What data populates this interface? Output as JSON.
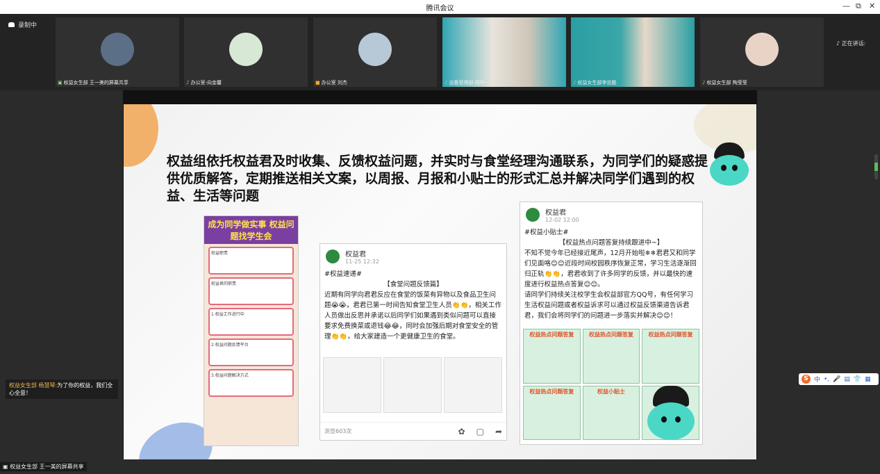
{
  "window": {
    "title": "腾讯会议",
    "controls": [
      "—",
      "⧉",
      "✕"
    ]
  },
  "recording": {
    "label": "录制中"
  },
  "participants": [
    {
      "name": "权益女生部 王一美的屏幕共享",
      "avatar_color": "#5b6f86",
      "type": "avatar"
    },
    {
      "name": "办公室-向金馨",
      "avatar_color": "#d7e9d4",
      "type": "avatar"
    },
    {
      "name": "办公室 刘杰",
      "avatar_color": "#b7c9d6",
      "type": "avatar"
    },
    {
      "name": "设备管理部-顾梓一",
      "avatar_color": "#46b6bf",
      "type": "camera"
    },
    {
      "name": "权益女生部李忠懿",
      "avatar_color": "#3aa6a8",
      "type": "camera"
    },
    {
      "name": "权益女生部 陶莹莹",
      "avatar_color": "#e9d3c7",
      "type": "avatar"
    }
  ],
  "speaking": {
    "label": "正在讲话:"
  },
  "slide": {
    "headline": "权益组依托权益君及时收集、反馈权益问题，并实时与食堂经理沟通联系，为同学们的疑惑提供优质解答，定期推送相关文案，以周报、月报和小贴士的形式汇总并解决同学们遇到的权益、生活等问题",
    "poster": {
      "header": "成为同学做实事 权益问题找学生会",
      "sections": [
        "权益职责",
        "权益君的职责",
        "1.权益工作进行中",
        "2.权益问题反馈平台",
        "3.权益问题解决方式"
      ]
    },
    "post1": {
      "account": "权益君",
      "date": "11-25 12:32",
      "tag": "#权益速递#",
      "title": "【食堂问题反馈篇】",
      "body": "近期有同学向君君反应在食堂的饭菜有异物以及食品卫生问题😭😭，君君已第一时间告知食堂卫生人员👏👏，相关工作人员做出反思并承诺以后同学们如果遇到类似问题可以直接要求免费换菜或退钱😂😂，同时会加强后期对食堂安全的管理👏👏，给大家建造一个更健康卫生的食堂。",
      "views": "浏览603次"
    },
    "post2": {
      "account": "权益君",
      "date": "12-02 12:00",
      "tag": "#权益小贴士#",
      "title": "【权益热点问题答复持续跟进中~】",
      "body": "不知不觉今年已经接近尾声，12月开始啦❄❄君君又和同学们见面咯😊😊近段时间校园秩序恢复正常，学习生活逐渐回归正轨👏👏，君君收到了许多同学的反馈，并以最快的速度进行权益热点答复😊😊。",
      "body2": "请同学们持续关注校学生会权益部官方QQ号，有任何学习生活权益问题或者权益诉求可以通过权益反馈渠道告诉君君，我们会将同学们的问题进一步落实并解决😊😊！",
      "cards": [
        "权益热点问题答复",
        "权益热点问题答复",
        "权益热点问题答复",
        "权益热点问题答复",
        "权益小贴士",
        ""
      ]
    }
  },
  "chat": {
    "sender": "权益女生部 杨慧琴:",
    "message": "为了你的权益，我们全心全意！"
  },
  "share_bar": {
    "label": "权益女生部 王一美的屏幕共享"
  },
  "ime": {
    "items": [
      "中",
      "•,",
      "🎤",
      "▤",
      "👕",
      "▦"
    ]
  }
}
